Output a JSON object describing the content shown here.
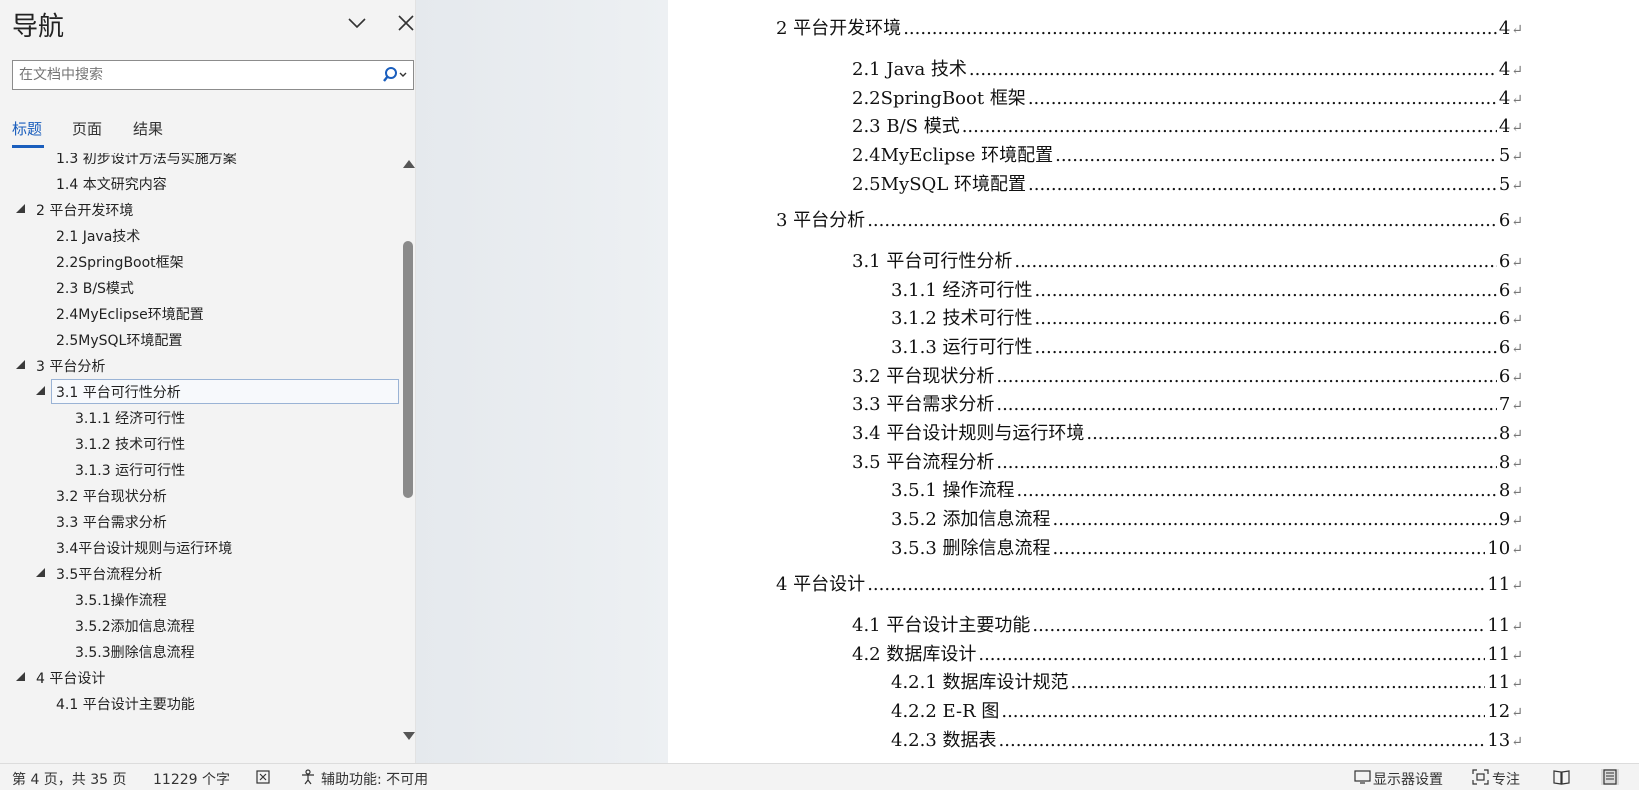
{
  "nav": {
    "title": "导航",
    "search_placeholder": "在文档中搜索",
    "tabs": [
      {
        "label": "标题",
        "active": true
      },
      {
        "label": "页面",
        "active": false
      },
      {
        "label": "结果",
        "active": false
      }
    ],
    "tree": [
      {
        "label": "1.3 初步设计方法与实施方案",
        "level": 2,
        "expander": false
      },
      {
        "label": "1.4 本文研究内容",
        "level": 2,
        "expander": false
      },
      {
        "label": "2 平台开发环境",
        "level": 1,
        "expander": true
      },
      {
        "label": "2.1 Java技术",
        "level": 2,
        "expander": false
      },
      {
        "label": "2.2SpringBoot框架",
        "level": 2,
        "expander": false
      },
      {
        "label": "2.3 B/S模式",
        "level": 2,
        "expander": false
      },
      {
        "label": "2.4MyEclipse环境配置",
        "level": 2,
        "expander": false
      },
      {
        "label": "2.5MySQL环境配置",
        "level": 2,
        "expander": false
      },
      {
        "label": "3 平台分析",
        "level": 1,
        "expander": true
      },
      {
        "label": "3.1 平台可行性分析",
        "level": 2,
        "expander": true,
        "selected": true
      },
      {
        "label": "3.1.1 经济可行性",
        "level": 3,
        "expander": false
      },
      {
        "label": "3.1.2 技术可行性",
        "level": 3,
        "expander": false
      },
      {
        "label": "3.1.3 运行可行性",
        "level": 3,
        "expander": false
      },
      {
        "label": "3.2 平台现状分析",
        "level": 2,
        "expander": false
      },
      {
        "label": "3.3 平台需求分析",
        "level": 2,
        "expander": false
      },
      {
        "label": "3.4平台设计规则与运行环境",
        "level": 2,
        "expander": false
      },
      {
        "label": "3.5平台流程分析",
        "level": 2,
        "expander": true
      },
      {
        "label": "3.5.1操作流程",
        "level": 3,
        "expander": false
      },
      {
        "label": "3.5.2添加信息流程",
        "level": 3,
        "expander": false
      },
      {
        "label": "3.5.3删除信息流程",
        "level": 3,
        "expander": false
      },
      {
        "label": "4 平台设计",
        "level": 1,
        "expander": true
      },
      {
        "label": "4.1 平台设计主要功能",
        "level": 2,
        "expander": false
      }
    ]
  },
  "document": {
    "toc": [
      {
        "title": "2  平台开发环境",
        "page": "4",
        "level": 1
      },
      {
        "title": "2.1 Java 技术",
        "page": "4",
        "level": 2
      },
      {
        "title": "2.2SpringBoot 框架",
        "page": "4",
        "level": 2
      },
      {
        "title": "2.3 B/S 模式",
        "page": "4",
        "level": 2
      },
      {
        "title": "2.4MyEclipse 环境配置",
        "page": "5",
        "level": 2
      },
      {
        "title": "2.5MySQL 环境配置",
        "page": "5",
        "level": 2
      },
      {
        "title": "3  平台分析",
        "page": "6",
        "level": 1
      },
      {
        "title": "3.1  平台可行性分析",
        "page": "6",
        "level": 2
      },
      {
        "title": "3.1.1  经济可行性",
        "page": "6",
        "level": 3
      },
      {
        "title": "3.1.2  技术可行性",
        "page": "6",
        "level": 3
      },
      {
        "title": "3.1.3  运行可行性",
        "page": "6",
        "level": 3
      },
      {
        "title": "3.2  平台现状分析",
        "page": "6",
        "level": 2
      },
      {
        "title": "3.3  平台需求分析",
        "page": "7",
        "level": 2
      },
      {
        "title": "3.4 平台设计规则与运行环境",
        "page": "8",
        "level": 2
      },
      {
        "title": "3.5 平台流程分析",
        "page": "8",
        "level": 2
      },
      {
        "title": "3.5.1 操作流程",
        "page": "8",
        "level": 3
      },
      {
        "title": "3.5.2 添加信息流程",
        "page": "9",
        "level": 3
      },
      {
        "title": "3.5.3 删除信息流程",
        "page": "10",
        "level": 3
      },
      {
        "title": "4  平台设计",
        "page": "11",
        "level": 1
      },
      {
        "title": "4.1  平台设计主要功能",
        "page": "11",
        "level": 2
      },
      {
        "title": "4.2  数据库设计",
        "page": "11",
        "level": 2
      },
      {
        "title": "4.2.1  数据库设计规范",
        "page": "11",
        "level": 3
      },
      {
        "title": "4.2.2 E-R 图",
        "page": "12",
        "level": 3
      },
      {
        "title": "4.2.3  数据表",
        "page": "13",
        "level": 3
      }
    ]
  },
  "status": {
    "page_info": "第 4 页，共 35 页",
    "word_count": "11229 个字",
    "accessibility": "辅助功能: 不可用",
    "display_settings": "显示器设置",
    "focus": "专注"
  },
  "colors": {
    "accent": "#1a5ebd"
  }
}
